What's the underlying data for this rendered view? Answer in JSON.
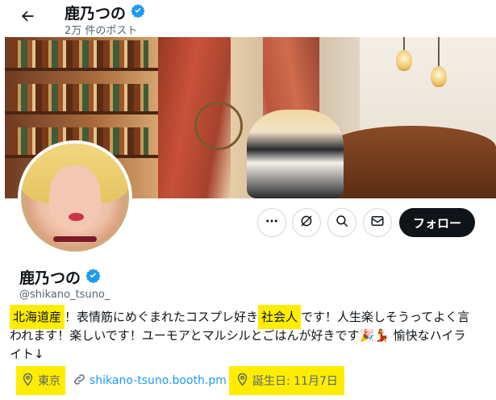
{
  "header": {
    "title": "鹿乃つの",
    "post_count": "2万 件のポスト"
  },
  "profile": {
    "name": "鹿乃つの",
    "handle": "@shikano_tsuno_",
    "bio": {
      "line1": {
        "hl1": "北海道産",
        "mid1": "！表情筋にめぐまれたコスプレ好き",
        "hl2": "社会人",
        "tail1": "です！人生楽しそうってよく言"
      },
      "line2": {
        "text": "われます！楽しいです！ユーモアとマルシルとごはんが好きです",
        "emoji": "🎉💃",
        "tail": " 愉快なハイラ"
      },
      "line3": "イト↓"
    },
    "location": "東京",
    "website": "shikano-tsuno.booth.pm",
    "birthday": "誕生日: 11月7日"
  },
  "actions": {
    "follow_label": "フォロー"
  },
  "icons": [
    "back-arrow-icon",
    "verified-badge-icon",
    "more-icon",
    "grok-icon",
    "search-icon",
    "message-icon",
    "location-icon",
    "link-icon",
    "birthday-icon"
  ],
  "colors": {
    "verified": "#1d9bf0",
    "link": "#1d9bf0",
    "highlight": "#ffed00",
    "follow_bg": "#0f1419",
    "muted": "#536471"
  }
}
